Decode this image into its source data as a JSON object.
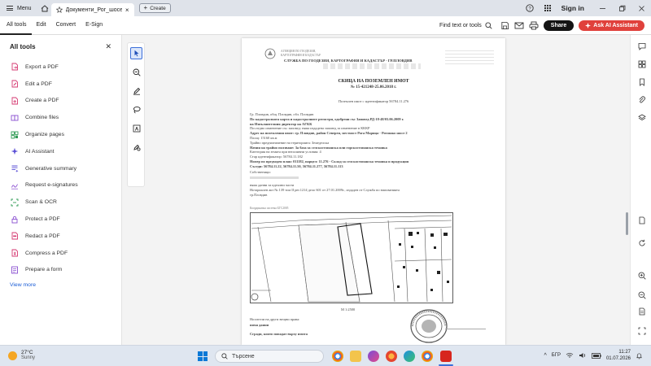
{
  "titlebar": {
    "menu_label": "Menu",
    "tab_title": "Документи_Рог_шосе...",
    "create_label": "Create",
    "signin_label": "Sign in"
  },
  "toolbar": {
    "tabs": [
      {
        "label": "All tools",
        "active": true
      },
      {
        "label": "Edit",
        "active": false
      },
      {
        "label": "Convert",
        "active": false
      },
      {
        "label": "E-Sign",
        "active": false
      }
    ],
    "find_label": "Find text or tools",
    "share_label": "Share",
    "ai_label": "Ask AI Assistant"
  },
  "left_panel": {
    "title": "All tools",
    "items": [
      {
        "label": "Export a PDF",
        "icon": "export-pdf-icon",
        "color": "#d63a72"
      },
      {
        "label": "Edit a PDF",
        "icon": "edit-pdf-icon",
        "color": "#d63a72"
      },
      {
        "label": "Create a PDF",
        "icon": "create-pdf-icon",
        "color": "#d63a72"
      },
      {
        "label": "Combine files",
        "icon": "combine-files-icon",
        "color": "#8a4fd1"
      },
      {
        "label": "Organize pages",
        "icon": "organize-pages-icon",
        "color": "#2f9b55"
      },
      {
        "label": "AI Assistant",
        "icon": "ai-assistant-icon",
        "color": "#5a4fd6"
      },
      {
        "label": "Generative summary",
        "icon": "generative-summary-icon",
        "color": "#5a4fd6"
      },
      {
        "label": "Request e-signatures",
        "icon": "request-esign-icon",
        "color": "#8a4fd1"
      },
      {
        "label": "Scan & OCR",
        "icon": "scan-ocr-icon",
        "color": "#2f9b55"
      },
      {
        "label": "Protect a PDF",
        "icon": "protect-pdf-icon",
        "color": "#8a4fd1"
      },
      {
        "label": "Redact a PDF",
        "icon": "redact-pdf-icon",
        "color": "#d63a72"
      },
      {
        "label": "Compress a PDF",
        "icon": "compress-pdf-icon",
        "color": "#d63a72"
      },
      {
        "label": "Prepare a form",
        "icon": "prepare-form-icon",
        "color": "#8a4fd1"
      }
    ],
    "view_more": "View more"
  },
  "document": {
    "header_lines": [
      "СЛУЖБА ПО ГЕОДЕЗИЯ, КАРТОГРАФИЯ И КАДАСТЪР - ГР.ПЛОВДИВ"
    ],
    "title": "СКИЦА НА ПОЗЕМЛЕН ИМОТ",
    "number_line": "№ 15-421248-25.06.2018 г.",
    "subtitle": "Поземлен имот с идентификатор 56784.11.276",
    "body_lines": [
      "Гр. Пловдив, общ. Пловдив, обл. Пловдив",
      "По кадастралната карта и кадастралните регистри, одобрени със Заповед РД-18-48/03.06.2009 г.",
      "на Изпълнителния директор на АГКК",
      "Последно изменение със заповед: няма издадена заповед за изменение в КККР",
      "Адрес на поземления имот: гр. Пловдив, район Северен, местност Рога Марица - Ротошко шосе 2",
      "Площ: 15160 кв.м",
      "Трайно предназначение на територията: Земеделска",
      "Начин на трайно ползване: За база за селскостопанска или горскостопанска техника",
      "Категория на земята при неполивни условия: 4",
      "Стар идентификатор: 56784.11.182",
      "Номер по предходен план: 011182, парцел: 11.276 - Склад за селскостопанска техника и продукция",
      "Съседи: 56784.11.22, 56784.11.50, 56784.11.277, 56784.11.113"
    ],
    "owners_heading": "Собственици:",
    "owners_lines": [
      "няма данни за идеални части",
      "Нотариален акт № 139 том II рег.1214 дело 601 от 27.01.2009г., издаден от Служба по вписванията",
      "гр.Пловдив"
    ],
    "map_caption": "Координатна система БГС2005",
    "scale": "M 1:2500",
    "footer_lines": [
      "Носители на други вещни права:",
      "няма данни",
      "Сгради, които попадат върху имота"
    ]
  },
  "taskbar": {
    "temperature": "27°C",
    "condition": "Sunny",
    "search_placeholder": "Търсене",
    "language": "БГР",
    "time": "11:27",
    "date": "01.07.2026"
  }
}
